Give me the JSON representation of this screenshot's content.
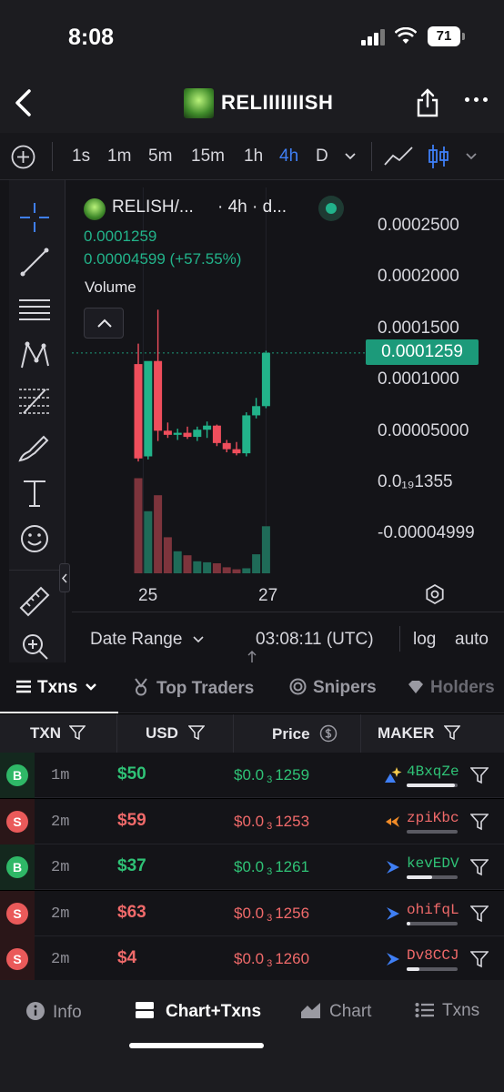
{
  "status": {
    "time": "8:08",
    "battery": "71"
  },
  "header": {
    "title": "RELIIIIIIISH"
  },
  "toolbar": {
    "timeframes": [
      "1s",
      "1m",
      "5m",
      "15m",
      "1h",
      "4h",
      "D"
    ],
    "active_timeframe": "4h"
  },
  "chart_legend": {
    "symbol": "RELISH/...",
    "resolution": "· 4h · d...",
    "price": "0.0001259",
    "change": "0.00004599 (+57.55%)",
    "volume_label": "Volume"
  },
  "chart_data": {
    "type": "candlestick",
    "price_axis": [
      "0.0002500",
      "0.0002000",
      "0.0001500",
      "0.0001000",
      "0.00005000",
      "0.0₁₉1355",
      "-0.00004999"
    ],
    "current_price": "0.0001259",
    "x_ticks": [
      "25",
      "27"
    ],
    "candles": [
      {
        "o": 0.000115,
        "h": 0.000135,
        "l": 2e-05,
        "c": 2.3e-05
      },
      {
        "o": 2.5e-05,
        "h": 0.000112,
        "l": 2.2e-05,
        "c": 0.000118
      },
      {
        "o": 0.000118,
        "h": 0.000168,
        "l": 4e-05,
        "c": 5e-05
      },
      {
        "o": 5e-05,
        "h": 5.8e-05,
        "l": 4.3e-05,
        "c": 4.6e-05
      },
      {
        "o": 4.6e-05,
        "h": 5.2e-05,
        "l": 4.1e-05,
        "c": 4.8e-05
      },
      {
        "o": 4.8e-05,
        "h": 5.4e-05,
        "l": 4.2e-05,
        "c": 4.4e-05
      },
      {
        "o": 4.4e-05,
        "h": 5.4e-05,
        "l": 4e-05,
        "c": 5.1e-05
      },
      {
        "o": 5.1e-05,
        "h": 5.9e-05,
        "l": 4.3e-05,
        "c": 5.5e-05
      },
      {
        "o": 5.5e-05,
        "h": 5.6e-05,
        "l": 3.5e-05,
        "c": 3.8e-05
      },
      {
        "o": 3.8e-05,
        "h": 4.1e-05,
        "l": 2.9e-05,
        "c": 3.2e-05
      },
      {
        "o": 3.2e-05,
        "h": 3.9e-05,
        "l": 2.6e-05,
        "c": 2.8e-05
      },
      {
        "o": 2.8e-05,
        "h": 6.8e-05,
        "l": 2.5e-05,
        "c": 6.5e-05
      },
      {
        "o": 6.5e-05,
        "h": 8.2e-05,
        "l": 6.2e-05,
        "c": 7.4e-05
      },
      {
        "o": 7.4e-05,
        "h": 0.000128,
        "l": 7.2e-05,
        "c": 0.000126
      }
    ],
    "volumes": [
      0.95,
      0.62,
      0.78,
      0.36,
      0.22,
      0.18,
      0.12,
      0.11,
      0.1,
      0.06,
      0.04,
      0.05,
      0.19,
      0.47
    ]
  },
  "chart_footer": {
    "date_range": "Date Range",
    "time": "03:08:11 (UTC)",
    "log": "log",
    "auto": "auto"
  },
  "tabs": [
    "Txns",
    "Top Traders",
    "Snipers",
    "Holders"
  ],
  "table": {
    "headers": {
      "txn": "TXN",
      "usd": "USD",
      "price": "Price",
      "maker": "MAKER"
    },
    "rows": [
      {
        "type": "B",
        "age": "1m",
        "usd": "$50",
        "price_prefix": "$0.0",
        "price_sub": "3",
        "price_digits": "1259",
        "maker": "4BxqZe",
        "bar": 0.95
      },
      {
        "type": "S",
        "age": "2m",
        "usd": "$59",
        "price_prefix": "$0.0",
        "price_sub": "3",
        "price_digits": "1253",
        "maker": "zpiKbc",
        "bar": 0.0
      },
      {
        "type": "B",
        "age": "2m",
        "usd": "$37",
        "price_prefix": "$0.0",
        "price_sub": "3",
        "price_digits": "1261",
        "maker": "kevEDV",
        "bar": 0.5
      },
      {
        "type": "S",
        "age": "2m",
        "usd": "$63",
        "price_prefix": "$0.0",
        "price_sub": "3",
        "price_digits": "1256",
        "maker": "ohifqL",
        "bar": 0.08
      },
      {
        "type": "S",
        "age": "2m",
        "usd": "$4",
        "price_prefix": "$0.0",
        "price_sub": "3",
        "price_digits": "1260",
        "maker": "Dv8CCJ",
        "bar": 0.25
      }
    ]
  },
  "bottom_nav": [
    "Info",
    "Chart+Txns",
    "Chart",
    "Txns"
  ]
}
